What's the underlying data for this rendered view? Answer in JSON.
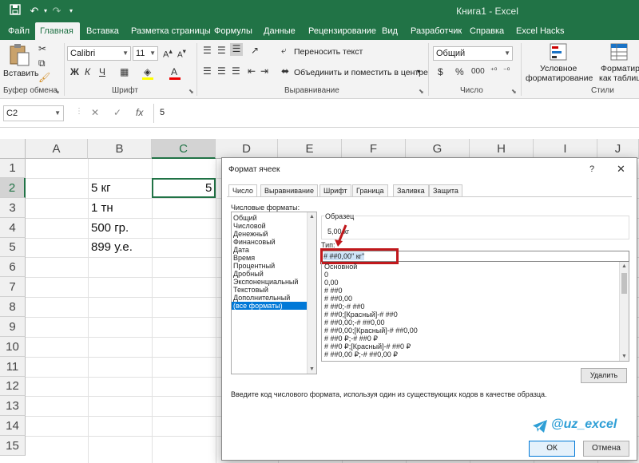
{
  "app": {
    "title": "Книга1 - Excel"
  },
  "quick_access": {
    "save_icon": "save-icon",
    "undo_icon": "undo-icon",
    "redo_icon": "redo-icon"
  },
  "ribbon_tabs": [
    "Файл",
    "Главная",
    "Вставка",
    "Разметка страницы",
    "Формулы",
    "Данные",
    "Рецензирование",
    "Вид",
    "Разработчик",
    "Справка",
    "Excel Hacks"
  ],
  "ribbon": {
    "clipboard": {
      "paste_label": "Вставить",
      "group_label": "Буфер обмена"
    },
    "font": {
      "font_name": "Calibri",
      "font_size": "11",
      "bold": "Ж",
      "italic": "К",
      "underline": "Ч",
      "group_label": "Шрифт"
    },
    "alignment": {
      "wrap_text": "Переносить текст",
      "merge_center": "Объединить и поместить в центре",
      "group_label": "Выравнивание"
    },
    "number": {
      "format": "Общий",
      "currency": "$",
      "percent": "%",
      "thousands": "000",
      "group_label": "Число"
    },
    "styles": {
      "conditional_formatting": "Условное",
      "conditional_formatting_2": "форматирование",
      "format_as_table": "Форматирова",
      "format_as_table_2": "как таблиц",
      "group_label": "Стили"
    }
  },
  "formula_bar": {
    "name_box": "C2",
    "value": "5",
    "cancel": "✕",
    "enter": "✓",
    "fx": "fx"
  },
  "columns": [
    "A",
    "B",
    "C",
    "D",
    "E",
    "F",
    "G",
    "H",
    "I",
    "J"
  ],
  "rows": [
    "1",
    "2",
    "3",
    "4",
    "5",
    "6",
    "7",
    "8",
    "9",
    "10",
    "11",
    "12",
    "13",
    "14",
    "15"
  ],
  "cells": {
    "B2": "5 кг",
    "C2": "5",
    "B3": "1 тн",
    "B4": "500 гр.",
    "B5": "899 у.е."
  },
  "dialog": {
    "title": "Формат ячеек",
    "help": "?",
    "close": "✕",
    "tabs": [
      "Число",
      "Выравнивание",
      "Шрифт",
      "Граница",
      "Заливка",
      "Защита"
    ],
    "active_tab": "Число",
    "categories_label": "Числовые форматы:",
    "categories": [
      "Общий",
      "Числовой",
      "Денежный",
      "Финансовый",
      "Дата",
      "Время",
      "Процентный",
      "Дробный",
      "Экспоненциальный",
      "Текстовый",
      "Дополнительный",
      "(все форматы)"
    ],
    "selected_category": "(все форматы)",
    "sample_label": "Образец",
    "sample_value": "5,00 кг",
    "type_label": "Тип:",
    "type_value": "# ##0,00\" кг\"",
    "formats": [
      "Основной",
      "0",
      "0,00",
      "# ##0",
      "# ##0,00",
      "# ##0;-# ##0",
      "# ##0;[Красный]-# ##0",
      "# ##0,00;-# ##0,00",
      "# ##0,00;[Красный]-# ##0,00",
      "# ##0 ₽;-# ##0 ₽",
      "# ##0 ₽;[Красный]-# ##0 ₽",
      "# ##0,00 ₽;-# ##0,00 ₽"
    ],
    "delete_button": "Удалить",
    "hint": "Введите код числового формата, используя один из существующих кодов в качестве образца.",
    "ok_button": "ОК",
    "cancel_button": "Отмена",
    "watermark": "@uz_excel"
  },
  "colors": {
    "excel_green": "#217346",
    "highlight_red": "#c0181c",
    "selection_blue": "#0078d7",
    "watermark_blue": "#2e9fd6"
  }
}
